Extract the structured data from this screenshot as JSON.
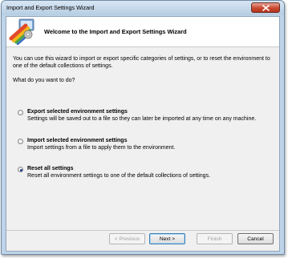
{
  "window": {
    "title": "Import and Export Settings Wizard"
  },
  "header": {
    "title": "Welcome to the Import and Export Settings Wizard"
  },
  "body": {
    "description": "You can use this wizard to import or export specific categories of settings, or to reset the environment to one of the default collections of settings.",
    "question": "What do you want to do?",
    "options": [
      {
        "label": "Export selected environment settings",
        "description": "Settings will be saved out to a file so they can later be imported at any time on any machine.",
        "selected": false
      },
      {
        "label": "Import selected environment settings",
        "description": "Import settings from a file to apply them to the environment.",
        "selected": false
      },
      {
        "label": "Reset all settings",
        "description": "Reset all environment settings to one of the default collections of settings.",
        "selected": true
      }
    ]
  },
  "footer": {
    "previous_label": "< Previous",
    "next_label": "Next >",
    "finish_label": "Finish",
    "cancel_label": "Cancel"
  },
  "colors": {
    "title_bar": "#bfd4e8",
    "close_button": "#c94a31",
    "radio_dot": "#1f3d8a"
  },
  "icons": [
    "wizard-logo-icon",
    "close-icon"
  ]
}
